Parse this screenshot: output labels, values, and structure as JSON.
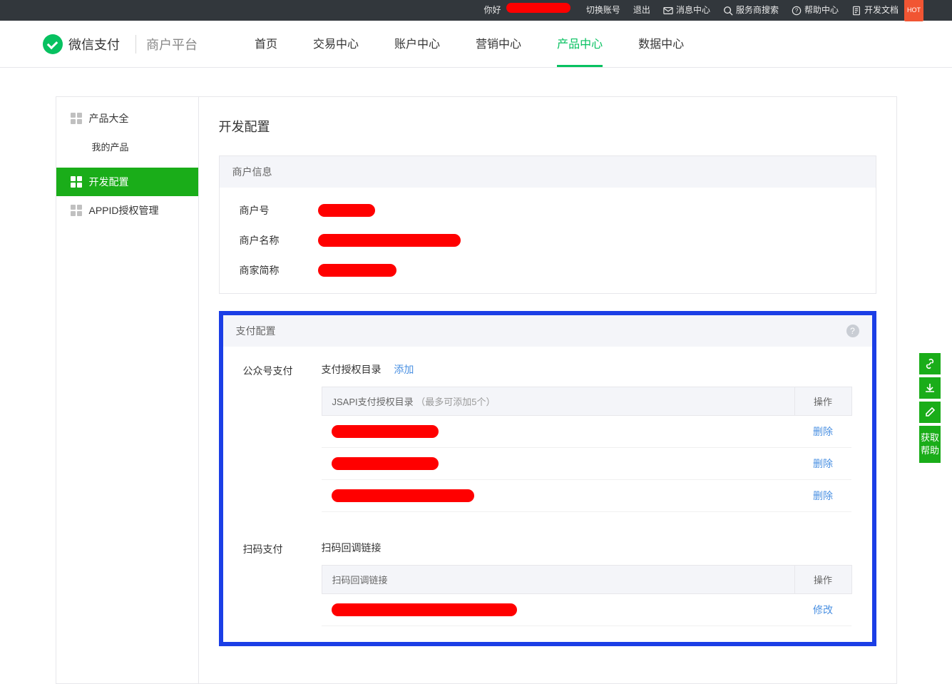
{
  "topbar": {
    "greeting": "你好",
    "switch_account": "切换账号",
    "logout": "退出",
    "message_center": "消息中心",
    "provider_search": "服务商搜索",
    "help_center": "帮助中心",
    "dev_docs": "开发文档",
    "hot": "HOT"
  },
  "header": {
    "brand": "微信支付",
    "sub": "商户平台",
    "nav": [
      "首页",
      "交易中心",
      "账户中心",
      "营销中心",
      "产品中心",
      "数据中心"
    ],
    "active_index": 4
  },
  "sidebar": {
    "cat": "产品大全",
    "my_products": "我的产品",
    "dev_config": "开发配置",
    "appid_mgmt": "APPID授权管理"
  },
  "page": {
    "title": "开发配置"
  },
  "merchant": {
    "panel_title": "商户信息",
    "id_label": "商户号",
    "name_label": "商户名称",
    "short_label": "商家简称"
  },
  "payconfig": {
    "panel_title": "支付配置",
    "jsapi_section": "公众号支付",
    "jsapi_title": "支付授权目录",
    "add": "添加",
    "jsapi_col": "JSAPI支付授权目录",
    "jsapi_hint": "（最多可添加5个）",
    "op_col": "操作",
    "delete": "删除",
    "scan_section": "扫码支付",
    "scan_title": "扫码回调链接",
    "scan_col": "扫码回调链接",
    "modify": "修改"
  },
  "rightrail": {
    "help": "获取帮助"
  }
}
